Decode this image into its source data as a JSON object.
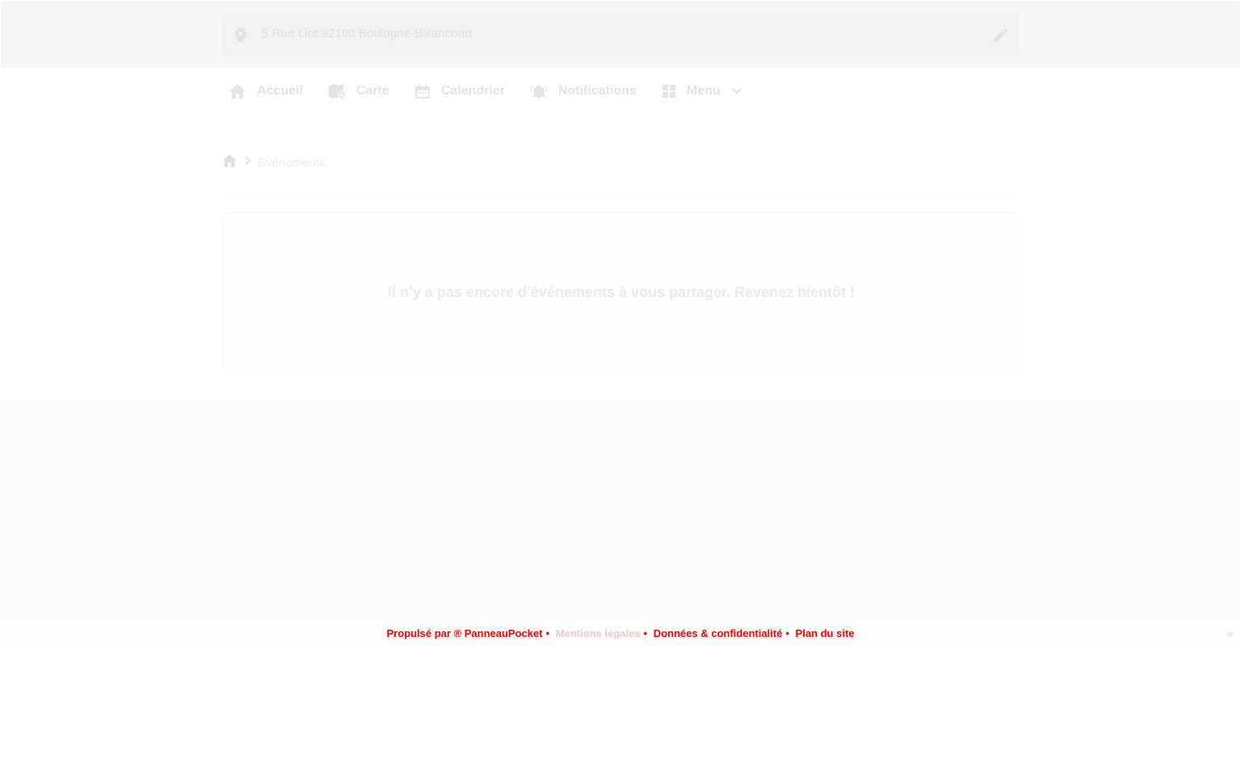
{
  "address": {
    "text": "5 Rue Liot 92100 Boulogne-Billancourt"
  },
  "nav": {
    "home": "Accueil",
    "map": "Carte",
    "calendar": "Calendrier",
    "notifications": "Notifications",
    "menu": "Menu"
  },
  "breadcrumb": {
    "current": "Événements"
  },
  "empty_state": {
    "message": "Il n’y a pas encore d’événements à vous partager. Revenez bientôt !"
  },
  "footer": {
    "propulsed": "Propulsé par ® PanneauPocket",
    "mentions": "Mentions légales",
    "privacy": "Données & confidentialité",
    "sitemap": "Plan du site"
  },
  "colors": {
    "accent": "#e00000",
    "topbar": "#f7f7f7",
    "band": "#fcfcfc"
  },
  "icons": [
    "map-pin-icon",
    "pencil-icon",
    "home-icon",
    "map-icon",
    "calendar-icon",
    "bell-ring-icon",
    "grid-icon",
    "chevron-down-icon",
    "chevron-right-icon"
  ]
}
